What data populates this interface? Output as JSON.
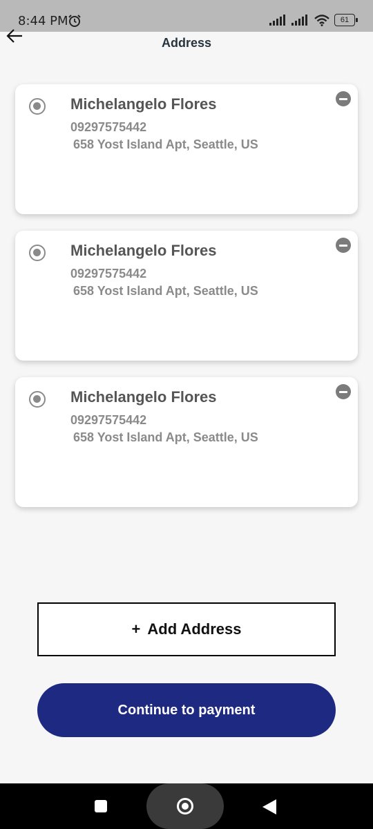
{
  "status_bar": {
    "time": "8:44 PM",
    "battery": "61",
    "icons": [
      "alarm-icon",
      "signal-icon",
      "signal-icon",
      "wifi-icon",
      "battery-icon"
    ]
  },
  "header": {
    "title": "Address",
    "back_icon": "arrow-left-icon"
  },
  "addresses": [
    {
      "name": "Michelangelo Flores",
      "phone": "09297575442",
      "address": "658 Yost Island Apt, Seattle, US",
      "radio_icon": "radio-selected-icon",
      "remove_icon": "remove-circle-icon"
    },
    {
      "name": "Michelangelo Flores",
      "phone": "09297575442",
      "address": "658 Yost Island Apt, Seattle, US",
      "radio_icon": "radio-selected-icon",
      "remove_icon": "remove-circle-icon"
    },
    {
      "name": "Michelangelo Flores",
      "phone": "09297575442",
      "address": "658 Yost Island Apt, Seattle, US",
      "radio_icon": "radio-selected-icon",
      "remove_icon": "remove-circle-icon"
    }
  ],
  "actions": {
    "add_icon": "+",
    "add_label": "Add Address",
    "continue_label": "Continue to payment"
  },
  "colors": {
    "primary": "#1e2a82",
    "background": "#f6f6f6",
    "status_bar": "#b9b9b9"
  },
  "nav_bar": {
    "icons": [
      "recents-square-icon",
      "home-circle-icon",
      "back-triangle-icon"
    ]
  }
}
